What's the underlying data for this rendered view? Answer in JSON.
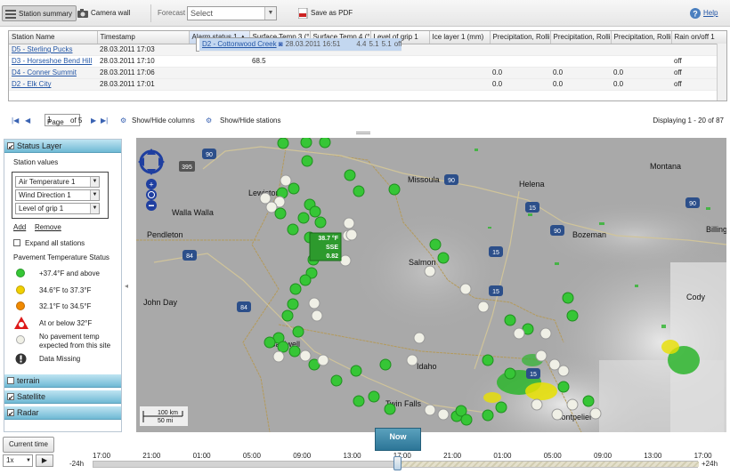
{
  "toolbar": {
    "station_summary": "Station summary",
    "camera_wall": "Camera wall",
    "forecast_label": "Forecast",
    "forecast_value": "Select",
    "save_pdf": "Save as PDF",
    "help": "Help"
  },
  "grid": {
    "columns": [
      "Station Name",
      "Timestamp",
      "Alarm status 1 ▲",
      "Surface Temp 3 (°F)",
      "Surface Temp 4 (°F)",
      "Level of grip 1",
      "Ice layer 1 (mm)",
      "Precipitation, Rolling",
      "Precipitation, Rolling",
      "Precipitation, Rolling",
      "Rain on/off 1"
    ],
    "rows": [
      [
        "D5 - Sterling Pucks",
        "28.03.2011 17:03",
        "",
        "",
        "",
        "",
        "",
        "",
        "",
        "",
        ""
      ],
      [
        "D3 - Horseshoe Bend Hill",
        "28.03.2011 17:10",
        "",
        "68.5",
        "",
        "",
        "",
        "",
        "",
        "",
        "off"
      ],
      [
        "D4 - Conner Summit",
        "28.03.2011 17:06",
        "",
        "",
        "",
        "",
        "",
        "0.0",
        "0.0",
        "0.0",
        "off"
      ],
      [
        "D2 - Cottonwood Creek",
        "28.03.2011 16:51",
        "",
        "",
        "",
        "",
        "",
        "4.4",
        "5.1",
        "5.1",
        "off"
      ],
      [
        "D2 - Elk City",
        "28.03.2011 17:01",
        "",
        "",
        "",
        "",
        "",
        "0.0",
        "0.0",
        "0.0",
        "off"
      ]
    ],
    "selected_row": 3
  },
  "pager": {
    "page_label": "Page",
    "page_value": "1",
    "of_label": "of 5",
    "show_hide_columns": "Show/Hide columns",
    "show_hide_stations": "Show/Hide stations",
    "displaying": "Displaying 1 - 20 of 87"
  },
  "panel": {
    "status_layer": "Status Layer",
    "station_values": "Station values",
    "dropdowns": [
      "Air Temperature 1",
      "Wind Direction 1",
      "Level of grip 1"
    ],
    "add": "Add",
    "remove": "Remove",
    "expand_all": "Expand all stations",
    "legend_title": "Pavement Temperature Status",
    "legend": [
      {
        "label": "+37.4°F and above",
        "color": "#36c636"
      },
      {
        "label": "34.6°F to 37.3°F",
        "color": "#f0d000"
      },
      {
        "label": "32.1°F to 34.5°F",
        "color": "#f08a00"
      },
      {
        "label": "At or below 32°F",
        "color": "#dd1a1a"
      },
      {
        "label": "No pavement temp expected from this site",
        "color": "#f0f0e6"
      },
      {
        "label": "Data Missing",
        "color": "#333333"
      }
    ],
    "layers": [
      "terrain",
      "Satellite",
      "Radar"
    ]
  },
  "map": {
    "cities": [
      "Missoula",
      "Helena",
      "Montana",
      "Walla Walla",
      "Lewiston",
      "Pendleton",
      "Salmon",
      "Bozeman",
      "Billings",
      "John Day",
      "Cody",
      "Caldwell",
      "Idaho",
      "Twin Falls",
      "Montpelier"
    ],
    "highways": [
      "395",
      "90",
      "84",
      "15",
      "90",
      "15",
      "15",
      "84",
      "90",
      "15",
      "90"
    ],
    "tooltip": [
      "38.7 °F",
      "SSE",
      "0.82"
    ],
    "scale_km": "100 km",
    "scale_mi": "50 mi"
  },
  "timeline": {
    "current_time": "Current time",
    "speed": "1x",
    "now": "Now",
    "minus": "-24h",
    "plus": "+24h",
    "ticks": [
      "17:00",
      "21:00",
      "01:00",
      "05:00",
      "09:00",
      "13:00",
      "17:00",
      "21:00",
      "01:00",
      "05:00",
      "09:00",
      "13:00",
      "17:00"
    ]
  }
}
